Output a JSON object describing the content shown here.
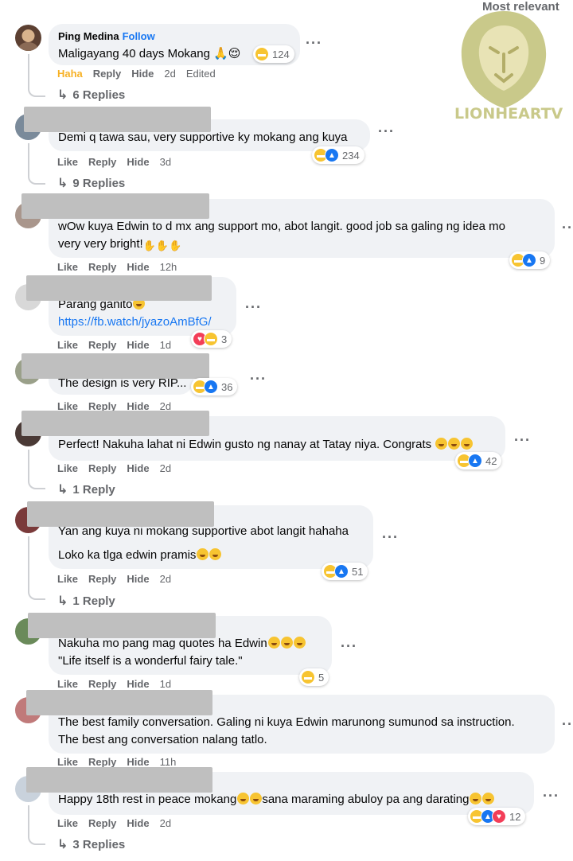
{
  "header": {
    "sort_label": "Most relevant"
  },
  "watermark": {
    "brand_text_main": "LIONHEAR",
    "brand_text_tail": "TV"
  },
  "comments": [
    {
      "author": "Ping Medina",
      "follow": "Follow",
      "text": "Maligayang 40 days Mokang 🙏😌",
      "reaction_count": "124",
      "actions": {
        "react": "Haha",
        "reply": "Reply",
        "hide": "Hide",
        "time": "2d",
        "edited": "Edited"
      },
      "replies": "6 Replies"
    },
    {
      "text": "Demi q tawa sau, very supportive ky mokang ang kuya",
      "reaction_count": "234",
      "actions": {
        "react": "Like",
        "reply": "Reply",
        "hide": "Hide",
        "time": "3d"
      },
      "replies": "9 Replies"
    },
    {
      "text_line1": "wOw kuya Edwin to d mx ang support mo, abot langit. good job sa galing ng idea mo",
      "text_line2": "very very bright!",
      "reaction_count": "9",
      "actions": {
        "react": "Like",
        "reply": "Reply",
        "hide": "Hide",
        "time": "12h"
      }
    },
    {
      "text_line1": "Parang ganito",
      "link": "https://fb.watch/jyazoAmBfG/",
      "reaction_count": "3",
      "actions": {
        "react": "Like",
        "reply": "Reply",
        "hide": "Hide",
        "time": "1d"
      }
    },
    {
      "text": "The design is very RIP...",
      "reaction_count": "36",
      "actions": {
        "react": "Like",
        "reply": "Reply",
        "hide": "Hide",
        "time": "2d"
      }
    },
    {
      "text": "Perfect! Nakuha lahat ni Edwin gusto ng nanay at Tatay niya. Congrats",
      "reaction_count": "42",
      "actions": {
        "react": "Like",
        "reply": "Reply",
        "hide": "Hide",
        "time": "2d"
      },
      "replies": "1 Reply"
    },
    {
      "text_line1": "Yan ang kuya ni mokang supportive abot langit hahaha",
      "text_line2": "Loko ka tlga edwin pramis",
      "reaction_count": "51",
      "actions": {
        "react": "Like",
        "reply": "Reply",
        "hide": "Hide",
        "time": "2d"
      },
      "replies": "1 Reply"
    },
    {
      "text_line1": "Nakuha mo pang mag quotes ha Edwin",
      "text_line2": "\"Life itself is a wonderful fairy tale.\"",
      "reaction_count": "5",
      "actions": {
        "react": "Like",
        "reply": "Reply",
        "hide": "Hide",
        "time": "1d"
      }
    },
    {
      "text_line1": "The best family conversation. Galing ni kuya Edwin marunong sumunod sa instruction.",
      "text_line2": "The best ang conversation nalang tatlo.",
      "actions": {
        "react": "Like",
        "reply": "Reply",
        "hide": "Hide",
        "time": "11h"
      }
    },
    {
      "text_part1": "Happy 18th rest in peace mokang",
      "text_part2": "sana maraming abuloy pa ang darating",
      "reaction_count": "12",
      "actions": {
        "react": "Like",
        "reply": "Reply",
        "hide": "Hide",
        "time": "2d"
      },
      "replies": "3 Replies"
    }
  ],
  "colors": {
    "link": "#1877f2",
    "haha_action": "#f7b125",
    "bubble": "#f0f2f5",
    "muted": "#65676b"
  }
}
